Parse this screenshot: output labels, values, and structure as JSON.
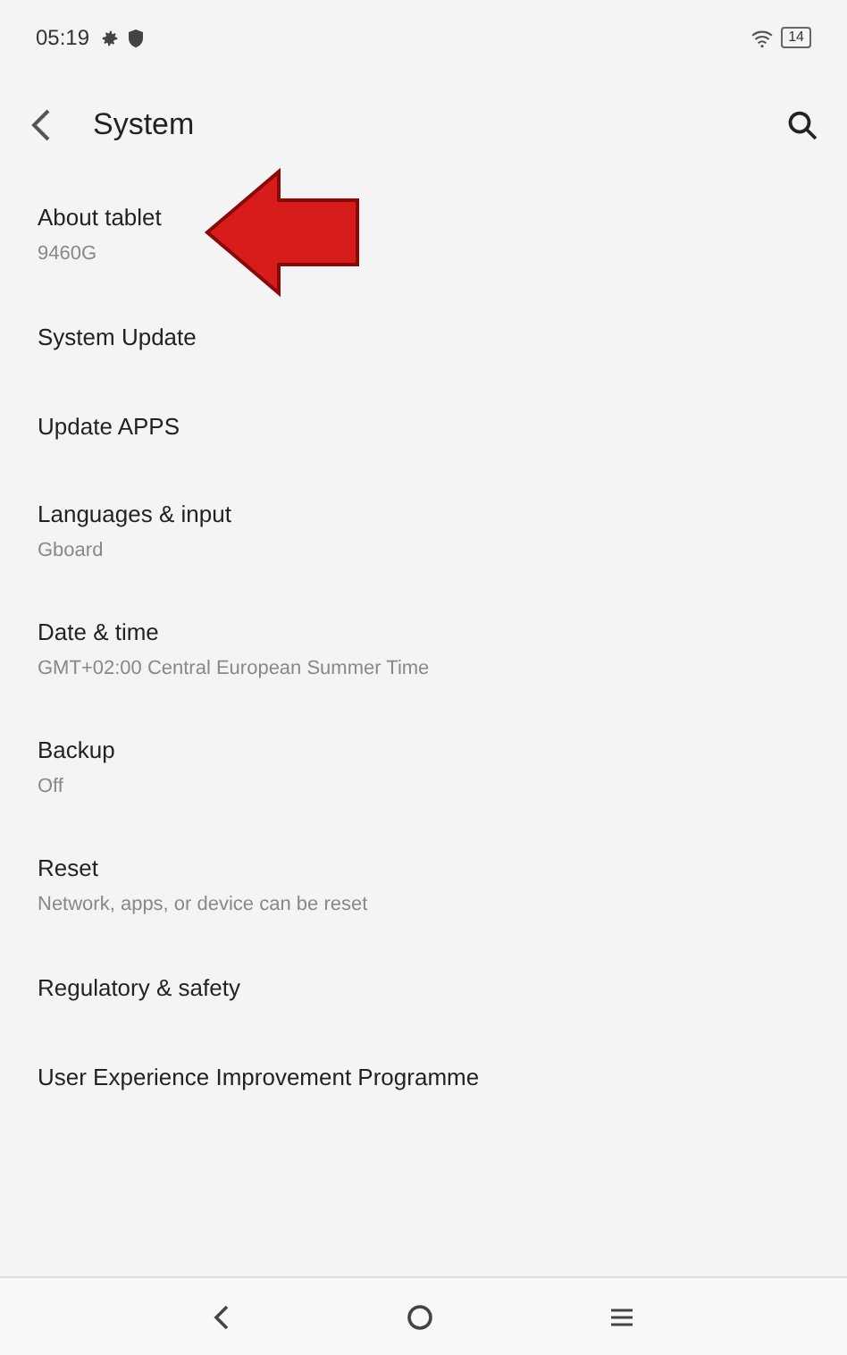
{
  "status_bar": {
    "time": "05:19",
    "battery": "14"
  },
  "header": {
    "title": "System"
  },
  "items": [
    {
      "title": "About tablet",
      "subtitle": "9460G",
      "highlighted": true
    },
    {
      "title": "System Update"
    },
    {
      "title": "Update APPS"
    },
    {
      "title": "Languages & input",
      "subtitle": "Gboard"
    },
    {
      "title": "Date & time",
      "subtitle": "GMT+02:00 Central European Summer Time"
    },
    {
      "title": "Backup",
      "subtitle": "Off"
    },
    {
      "title": "Reset",
      "subtitle": "Network, apps, or device can be reset"
    },
    {
      "title": "Regulatory & safety"
    },
    {
      "title": "User Experience Improvement Programme"
    }
  ]
}
